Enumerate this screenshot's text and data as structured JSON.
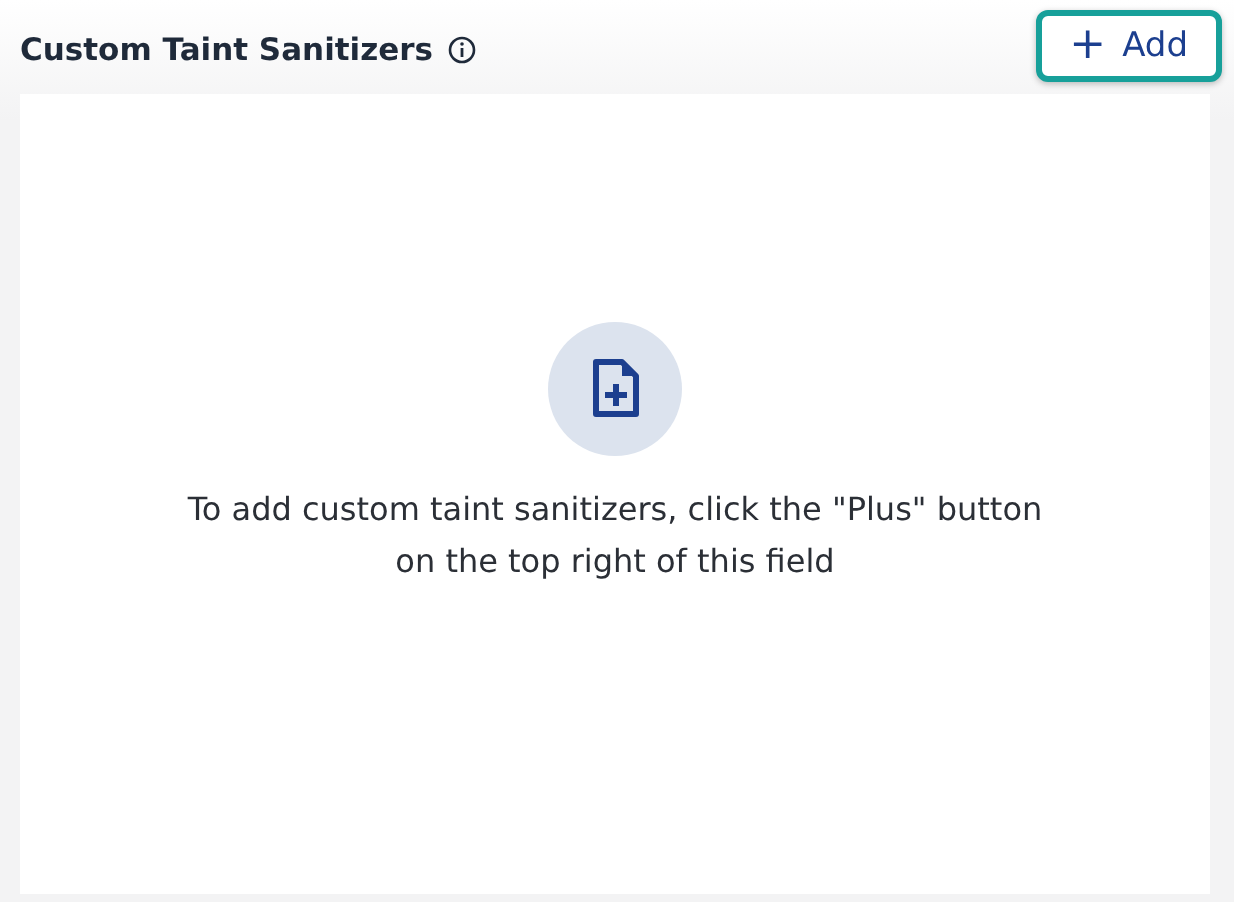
{
  "section": {
    "title": "Custom Taint Sanitizers"
  },
  "add_button": {
    "icon": "+",
    "label": "Add",
    "focused": true
  },
  "empty_state": {
    "message": "To add custom taint sanitizers, click the \"Plus\" button on the top right of this field"
  }
}
